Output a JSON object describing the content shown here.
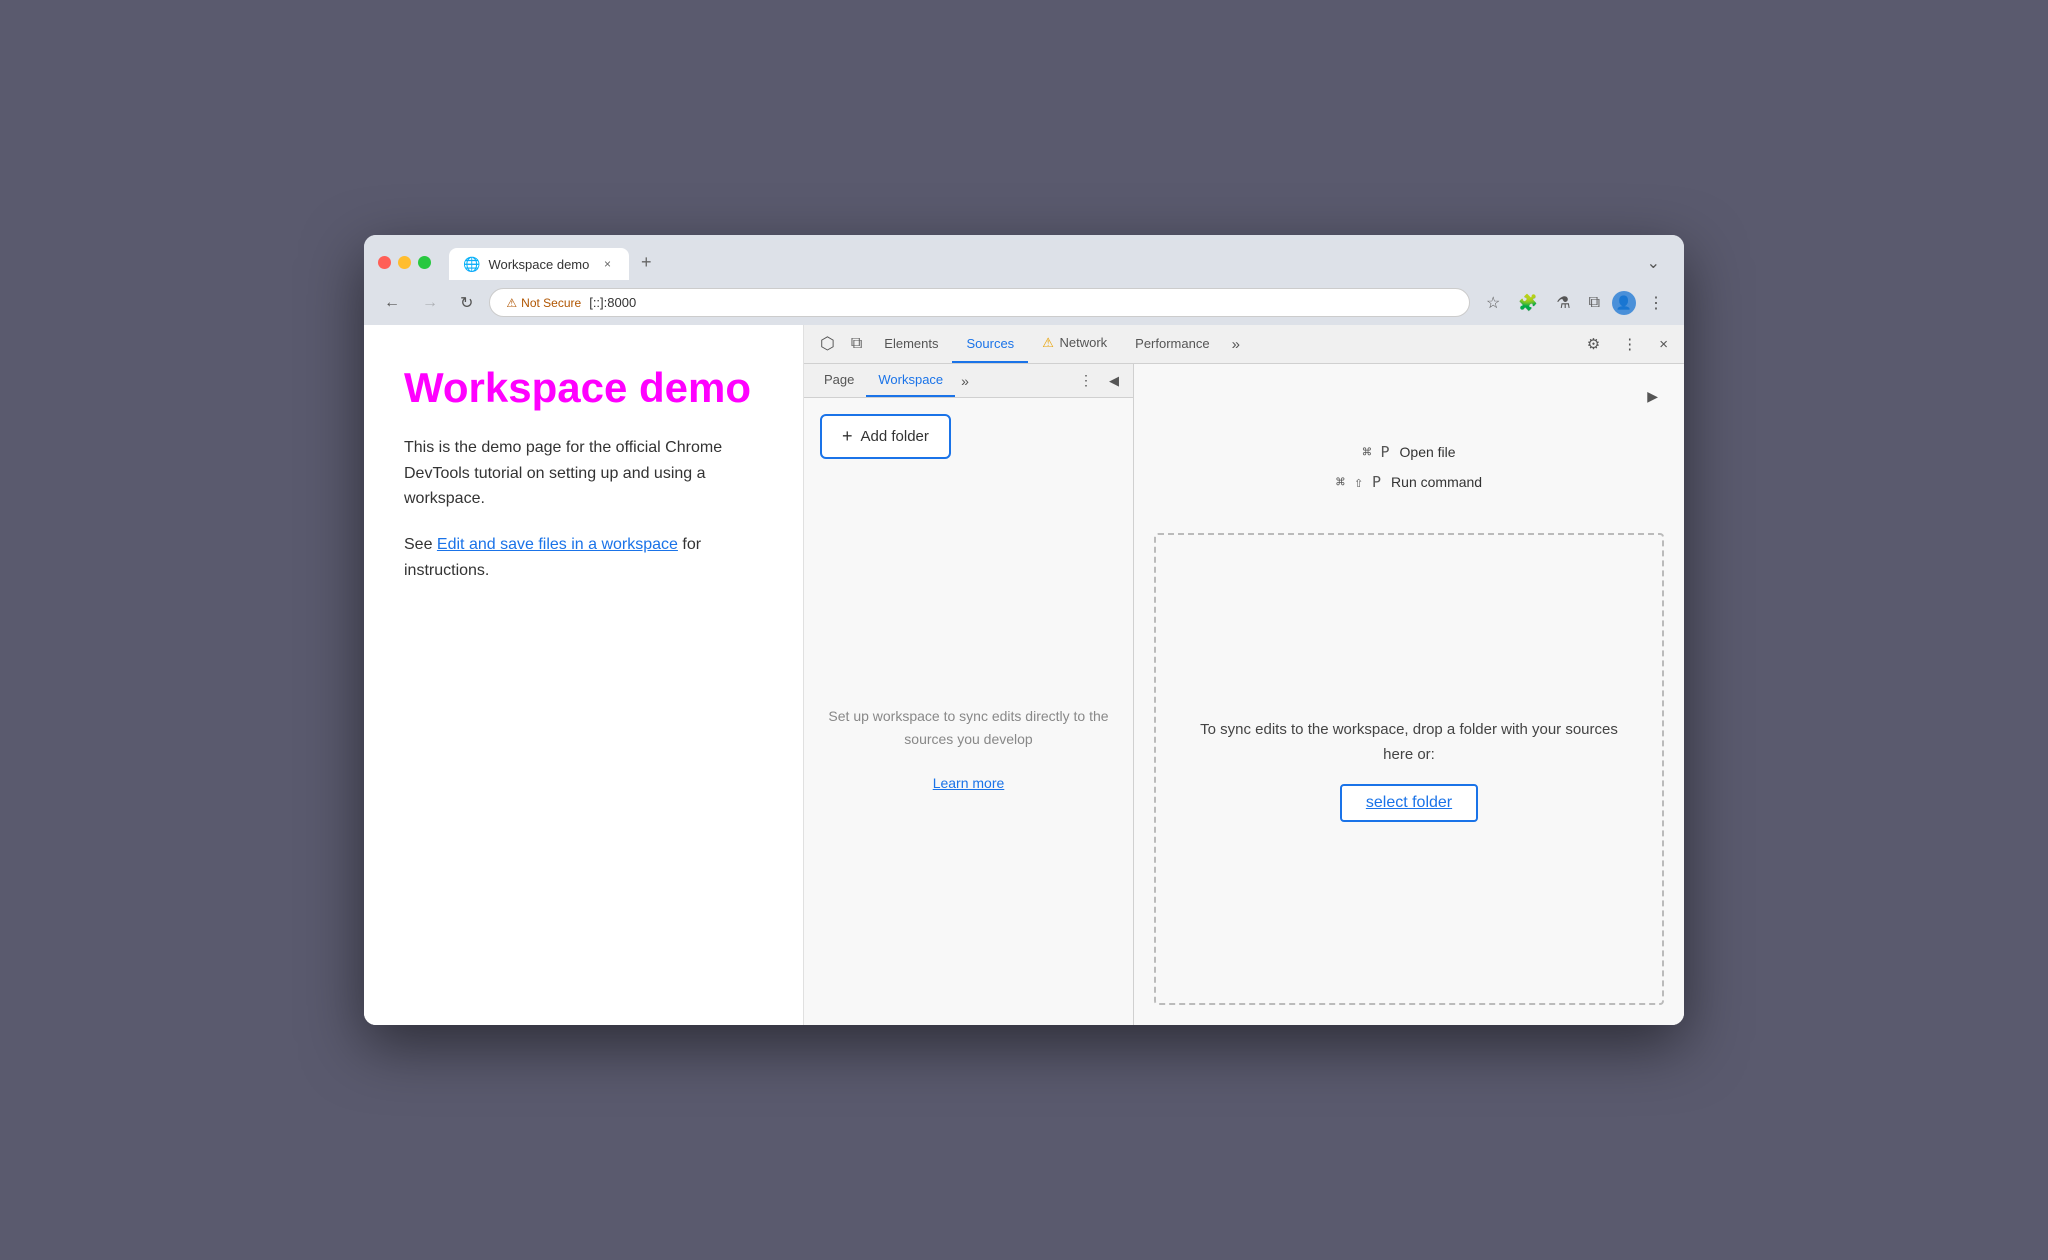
{
  "browser": {
    "tab": {
      "title": "Workspace demo",
      "icon": "🌐",
      "close_label": "×",
      "new_tab_label": "+"
    },
    "dropdown_label": "⌄",
    "nav": {
      "back_label": "←",
      "forward_label": "→",
      "reload_label": "↻"
    },
    "url": {
      "security_label": "Not Secure",
      "address": "[::]:8000"
    },
    "toolbar_icons": {
      "bookmark": "☆",
      "extensions": "🧩",
      "lab": "⚗",
      "split": "⧉",
      "profile": "👤",
      "menu": "⋮"
    }
  },
  "page": {
    "title": "Workspace demo",
    "description": "This is the demo page for the official Chrome DevTools tutorial on setting up and using a workspace.",
    "link_prefix": "See ",
    "link_text": "Edit and save files in a workspace",
    "link_suffix": " for instructions."
  },
  "devtools": {
    "tabs": [
      {
        "label": "Elements",
        "active": false
      },
      {
        "label": "Sources",
        "active": true
      },
      {
        "label": "Network",
        "active": false,
        "warning": true
      },
      {
        "label": "Performance",
        "active": false
      }
    ],
    "more_tabs_label": "»",
    "settings_label": "⚙",
    "more_options_label": "⋮",
    "close_label": "×",
    "inspect_toggle_label": "⬡",
    "device_toggle_label": "📱",
    "sub_tabs": [
      {
        "label": "Page",
        "active": false
      },
      {
        "label": "Workspace",
        "active": true
      }
    ],
    "more_sub_label": "»",
    "sub_menu_label": "⋮",
    "panel_collapse_left": "◀",
    "panel_collapse_right": "▶",
    "add_folder_label": "Add folder",
    "workspace_empty_text": "Set up workspace to sync edits directly to the sources you develop",
    "learn_more_label": "Learn more",
    "shortcuts": [
      {
        "key": "⌘ P",
        "action": "Open file"
      },
      {
        "key": "⌘ ⇧ P",
        "action": "Run command"
      }
    ],
    "drop_zone_text": "To sync edits to the workspace, drop a folder with your sources here or:",
    "select_folder_label": "select folder"
  }
}
